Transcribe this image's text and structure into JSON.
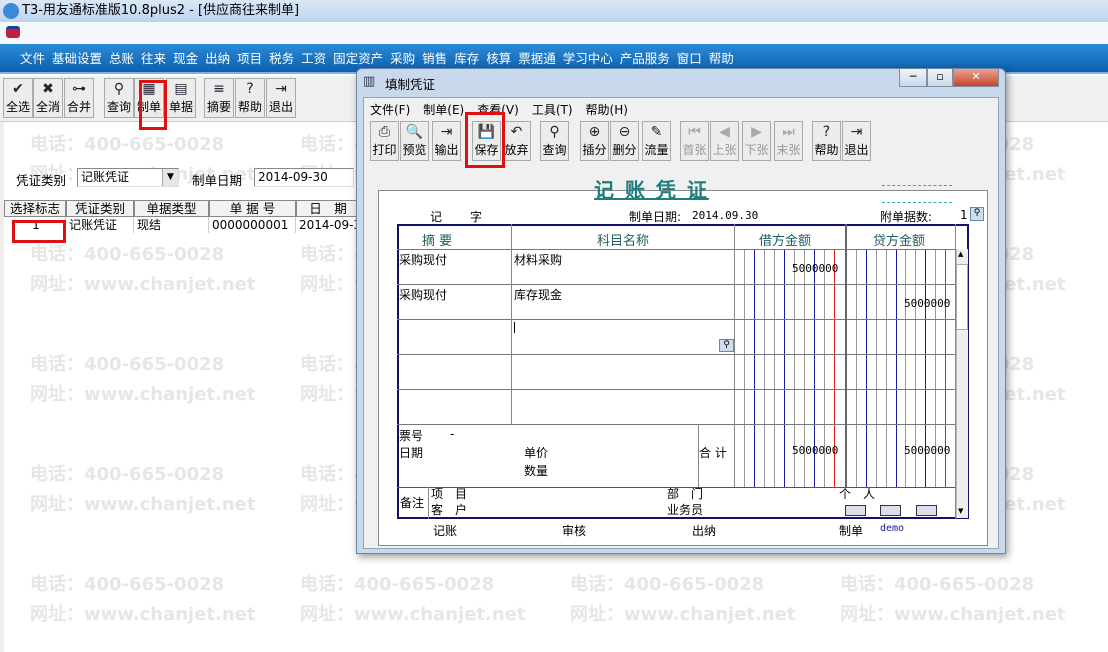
{
  "window": {
    "title": "T3-用友通标准版10.8plus2 - [供应商往来制单]"
  },
  "menu": [
    "文件",
    "基础设置",
    "总账",
    "往来",
    "现金",
    "出纳",
    "项目",
    "税务",
    "工资",
    "固定资产",
    "采购",
    "销售",
    "库存",
    "核算",
    "票据通",
    "学习中心",
    "产品服务",
    "窗口",
    "帮助"
  ],
  "toolbar": [
    {
      "label": "全选",
      "icon": "select-all-icon",
      "glyph": "✔"
    },
    {
      "label": "全消",
      "icon": "deselect-all-icon",
      "glyph": "✖"
    },
    {
      "label": "合并",
      "icon": "merge-icon",
      "glyph": "⊶"
    },
    {
      "label": "查询",
      "icon": "binoculars-icon",
      "glyph": "⚲"
    },
    {
      "label": "制单",
      "icon": "make-voucher-icon",
      "glyph": "▦"
    },
    {
      "label": "单据",
      "icon": "document-icon",
      "glyph": "▤"
    },
    {
      "label": "摘要",
      "icon": "summary-icon",
      "glyph": "≡"
    },
    {
      "label": "帮助",
      "icon": "help-icon",
      "glyph": "?"
    },
    {
      "label": "退出",
      "icon": "exit-icon",
      "glyph": "⇥"
    }
  ],
  "filter": {
    "type_label": "凭证类别",
    "type_value": "记账凭证",
    "date_label": "制单日期",
    "date_value": "2014-09-30"
  },
  "table": {
    "headers": [
      "选择标志",
      "凭证类别",
      "单据类型",
      "单 据 号",
      "日　期"
    ],
    "rows": [
      [
        "1",
        "记账凭证",
        "现结",
        "0000000001",
        "2014-09-3"
      ]
    ]
  },
  "watermark": {
    "phone": "电话：400-665-0028",
    "web": "网址：www.chanjet.net"
  },
  "dialog": {
    "title": "填制凭证",
    "menu": [
      "文件(F)",
      "制单(E)",
      "查看(V)",
      "工具(T)",
      "帮助(H)"
    ],
    "toolbar": [
      {
        "label": "打印",
        "glyph": "⎙",
        "icon": "print-icon"
      },
      {
        "label": "预览",
        "glyph": "🔍",
        "icon": "preview-icon"
      },
      {
        "label": "输出",
        "glyph": "⇥",
        "icon": "export-icon"
      },
      {
        "label": "保存",
        "glyph": "💾",
        "icon": "save-icon"
      },
      {
        "label": "放弃",
        "glyph": "↶",
        "icon": "discard-icon"
      },
      {
        "label": "查询",
        "glyph": "⚲",
        "icon": "binoculars-icon"
      },
      {
        "label": "插分",
        "glyph": "⊕",
        "icon": "insert-row-icon"
      },
      {
        "label": "删分",
        "glyph": "⊖",
        "icon": "delete-row-icon"
      },
      {
        "label": "流量",
        "glyph": "✎",
        "icon": "cash-flow-icon"
      },
      {
        "label": "首张",
        "glyph": "⏮",
        "icon": "first-icon",
        "disabled": true
      },
      {
        "label": "上张",
        "glyph": "◀",
        "icon": "prev-icon",
        "disabled": true
      },
      {
        "label": "下张",
        "glyph": "▶",
        "icon": "next-icon",
        "disabled": true
      },
      {
        "label": "末张",
        "glyph": "⏭",
        "icon": "last-icon",
        "disabled": true
      },
      {
        "label": "帮助",
        "glyph": "?",
        "icon": "help-icon"
      },
      {
        "label": "退出",
        "glyph": "⇥",
        "icon": "exit-icon"
      }
    ],
    "voucher": {
      "title": "记 账 凭 证",
      "type_char": "记",
      "zi": "字",
      "date_label": "制单日期:",
      "date": "2014.09.30",
      "attach_label": "附单据数:",
      "attach": "1",
      "headers": [
        "摘 要",
        "科目名称",
        "借方金额",
        "贷方金额"
      ],
      "rows": [
        {
          "summary": "采购现付",
          "account": "材料采购",
          "debit": "5000000",
          "credit": ""
        },
        {
          "summary": "采购现付",
          "account": "库存现金",
          "debit": "",
          "credit": "5000000"
        },
        {
          "summary": "",
          "account": "",
          "debit": "",
          "credit": ""
        },
        {
          "summary": "",
          "account": "",
          "debit": "",
          "credit": ""
        },
        {
          "summary": "",
          "account": "",
          "debit": "",
          "credit": ""
        }
      ],
      "bill_no_label": "票号",
      "bill_no": "-",
      "date2_label": "日期",
      "price_label": "单价",
      "qty_label": "数量",
      "total_label": "合 计",
      "total_debit": "5000000",
      "total_credit": "5000000",
      "remark_label": "备注",
      "project_label": "项　目",
      "customer_label": "客　户",
      "dept_label": "部　门",
      "salesman_label": "业务员",
      "person_label": "个　人",
      "footer": {
        "bookkeep": "记账",
        "audit": "审核",
        "cashier": "出纳",
        "maker_label": "制单",
        "maker": "demo"
      }
    }
  },
  "colors": {
    "menubar": "#0c5fae",
    "highlight": "#e01010",
    "voucher_title": "#1f7f7f",
    "ledger_blue": "#1a1aa0",
    "ledger_red": "#e02020"
  }
}
